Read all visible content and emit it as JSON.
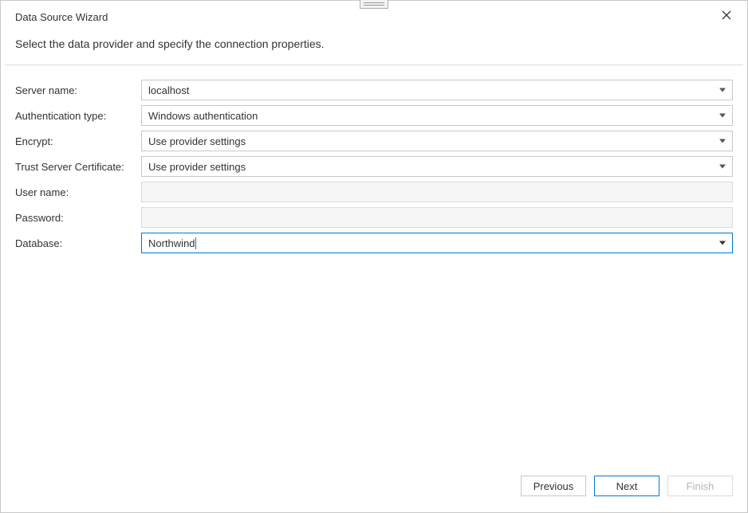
{
  "window": {
    "title": "Data Source Wizard",
    "instruction": "Select the data provider and specify the connection properties."
  },
  "form": {
    "server_name": {
      "label": "Server name:",
      "value": "localhost"
    },
    "auth_type": {
      "label": "Authentication type:",
      "value": "Windows authentication"
    },
    "encrypt": {
      "label": "Encrypt:",
      "value": "Use provider settings"
    },
    "trust_cert": {
      "label": "Trust Server Certificate:",
      "value": "Use provider settings"
    },
    "user_name": {
      "label": "User name:",
      "value": ""
    },
    "password": {
      "label": "Password:",
      "value": ""
    },
    "database": {
      "label": "Database:",
      "value": "Northwind"
    }
  },
  "buttons": {
    "previous": "Previous",
    "next": "Next",
    "finish": "Finish"
  }
}
